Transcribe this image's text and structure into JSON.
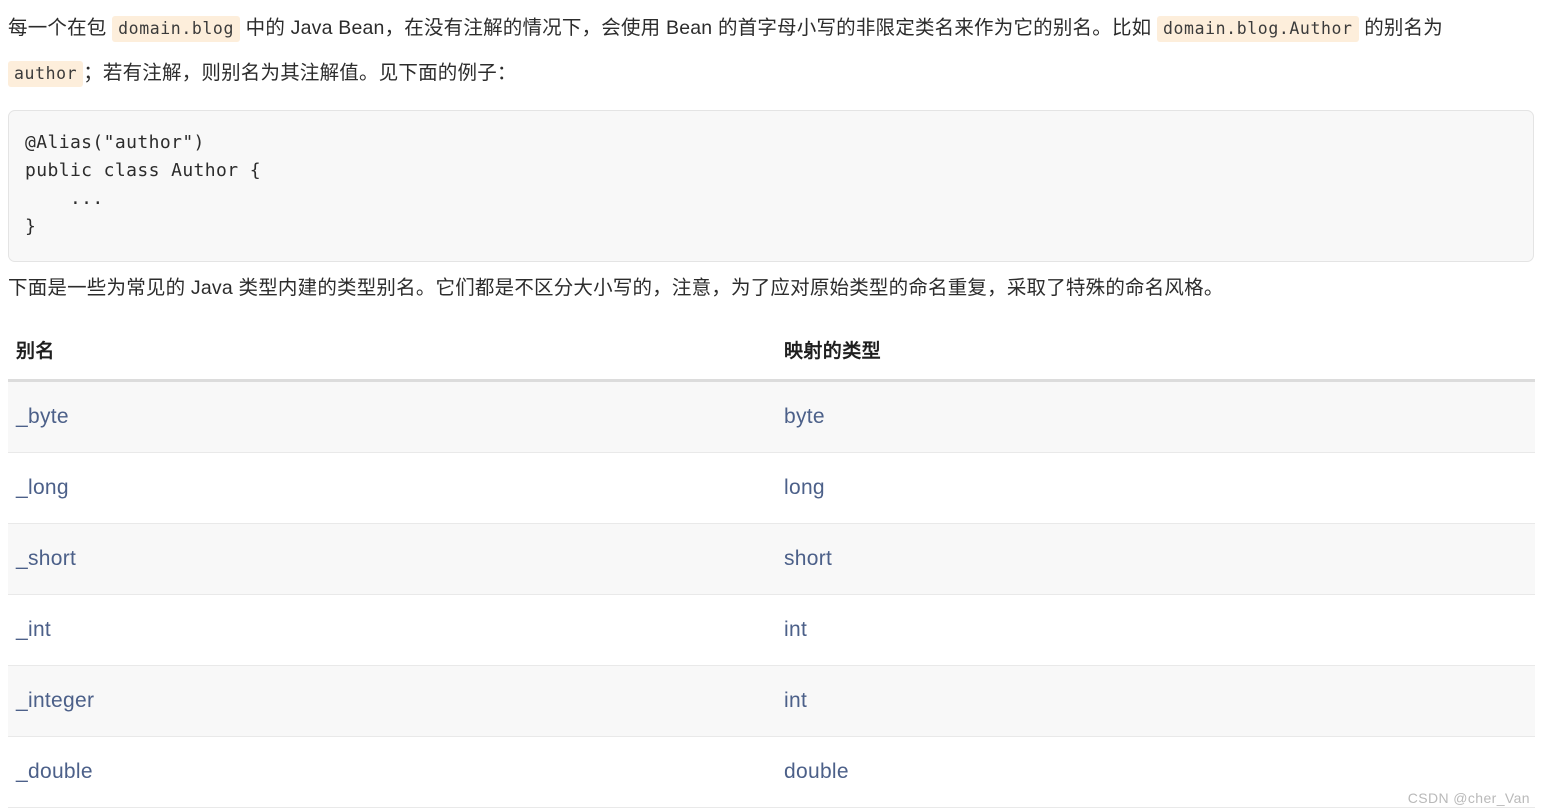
{
  "document": {
    "intro_paragraph": {
      "segment_1": "每一个在包 ",
      "code_1": "domain.blog",
      "segment_2": " 中的 Java Bean，在没有注解的情况下，会使用 Bean 的首字母小写的非限定类名来作为它的别名。比如 ",
      "code_2": "domain.blog.Author",
      "segment_3": " 的别名为 ",
      "code_3": "author",
      "segment_4": "；若有注解，则别名为其注解值。见下面的例子："
    },
    "code_block": {
      "language": "java",
      "content": "@Alias(\"author\")\npublic class Author {\n    ...\n}"
    },
    "types_paragraph": "下面是一些为常见的 Java 类型内建的类型别名。它们都是不区分大小写的，注意，为了应对原始类型的命名重复，采取了特殊的命名风格。"
  },
  "alias_table": {
    "columns": [
      {
        "key": "alias",
        "label": "别名"
      },
      {
        "key": "mapped_type",
        "label": "映射的类型"
      }
    ],
    "rows": [
      {
        "alias": "_byte",
        "mapped_type": "byte"
      },
      {
        "alias": "_long",
        "mapped_type": "long"
      },
      {
        "alias": "_short",
        "mapped_type": "short"
      },
      {
        "alias": "_int",
        "mapped_type": "int"
      },
      {
        "alias": "_integer",
        "mapped_type": "int"
      },
      {
        "alias": "_double",
        "mapped_type": "double"
      }
    ]
  },
  "watermark": {
    "text": "CSDN @cher_Van"
  },
  "colors": {
    "inline_code_background": "#fdeedb",
    "inline_code_text": "#3b3b3b",
    "code_block_background": "#f8f8f8",
    "code_block_border": "#e4e4e4",
    "table_cell_text": "#4c6089",
    "table_header_text": "#1f1f1f",
    "table_row_shaded": "#f8f8f8",
    "table_header_rule": "#dcdcdc",
    "body_text": "#2c2c2c",
    "watermark_text": "#b9b9b9"
  }
}
